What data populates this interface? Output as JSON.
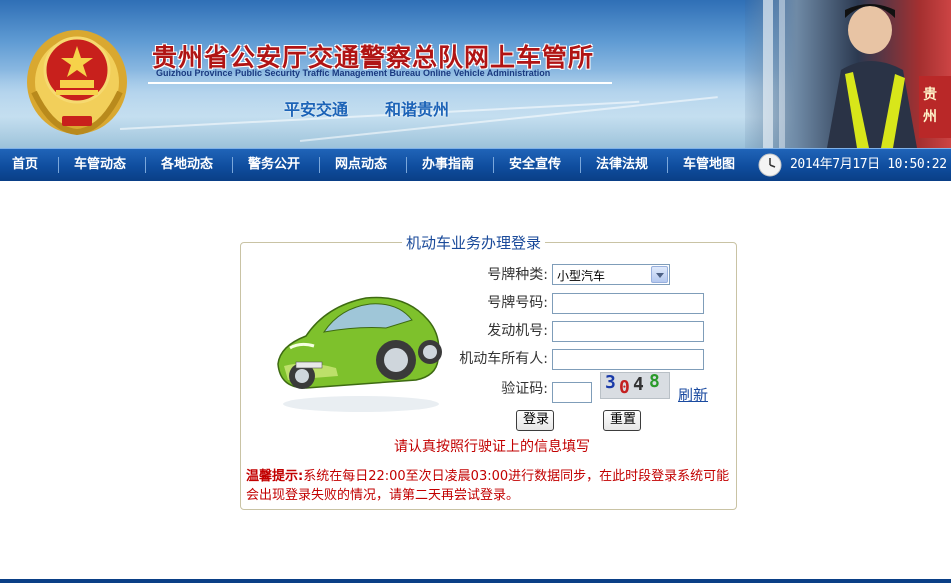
{
  "header": {
    "title_cn": "贵州省公安厅交通警察总队网上车管所",
    "title_en": "Guizhou Province Public Security Traffic Management Bureau Online Vehicle Administration",
    "slogan_left": "平安交通",
    "slogan_right": "和谐贵州",
    "police_sign": "贵州"
  },
  "nav": {
    "items": [
      {
        "label": "首页"
      },
      {
        "label": "车管动态"
      },
      {
        "label": "各地动态"
      },
      {
        "label": "警务公开"
      },
      {
        "label": "网点动态"
      },
      {
        "label": "办事指南"
      },
      {
        "label": "安全宣传"
      },
      {
        "label": "法律法规"
      },
      {
        "label": "车管地图"
      }
    ],
    "datetime": "2014年7月17日  10:50:22"
  },
  "login": {
    "legend": "机动车业务办理登录",
    "plate_type_label": "号牌种类:",
    "plate_type_value": "小型汽车",
    "plate_number_label": "号牌号码:",
    "plate_number_value": "",
    "engine_label": "发动机号:",
    "engine_value": "",
    "owner_label": "机动车所有人:",
    "owner_value": "",
    "captcha_label": "验证码:",
    "captcha_value": "",
    "captcha_chars": [
      "3",
      "0",
      "4",
      "8"
    ],
    "refresh_label": "刷新",
    "login_button": "登录",
    "reset_button": "重置",
    "hint": "请认真按照行驶证上的信息填写",
    "notice_title": "温馨提示:",
    "notice_text": "系统在每日22:00至次日凌晨03:00进行数据同步，在此时段登录系统可能会出现登录失败的情况，请第二天再尝试登录。"
  },
  "colors": {
    "nav_bg": "#0f4d9e",
    "title_red": "#b01414",
    "accent_blue": "#1a4a9a",
    "notice_red": "#c20000"
  }
}
